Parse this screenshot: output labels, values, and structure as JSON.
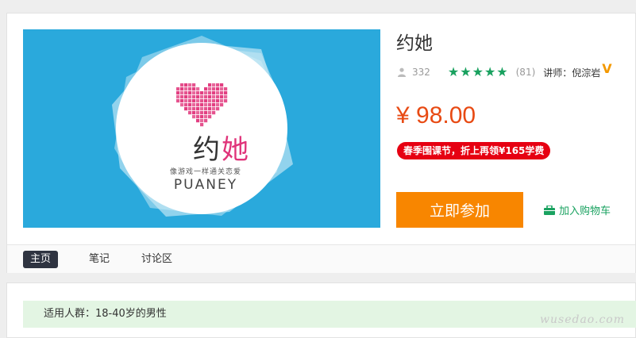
{
  "course": {
    "title": "约她",
    "students": "332",
    "stars": [
      "★",
      "★",
      "★",
      "★",
      "★"
    ],
    "rating_count": "(81)",
    "teacher": "讲师：倪淙岩",
    "teacher_badge": "V",
    "price": "¥ 98.00",
    "promo": "春季围课节，折上再领¥165学费",
    "join_label": "立即参加",
    "cart_label": "加入购物车"
  },
  "cover": {
    "logo_title_main": "约",
    "logo_title_accent": "她",
    "logo_sub": "像游戏一样通关恋爱",
    "logo_en": "PUANEY",
    "bg_color": "#2aa9dc",
    "heart_color": "#e0347a"
  },
  "tabs": [
    {
      "label": "主页",
      "active": true
    },
    {
      "label": "笔记",
      "active": false
    },
    {
      "label": "讨论区",
      "active": false
    }
  ],
  "audience": "适用人群：18-40岁的男性",
  "watermark": "wusedao.com",
  "colors": {
    "price": "#e84a13",
    "promo_bg": "#e60012",
    "join_bg": "#f88600",
    "stars": "#19a15f",
    "cart": "#1aa260",
    "tab_active_bg": "#2f3441"
  }
}
